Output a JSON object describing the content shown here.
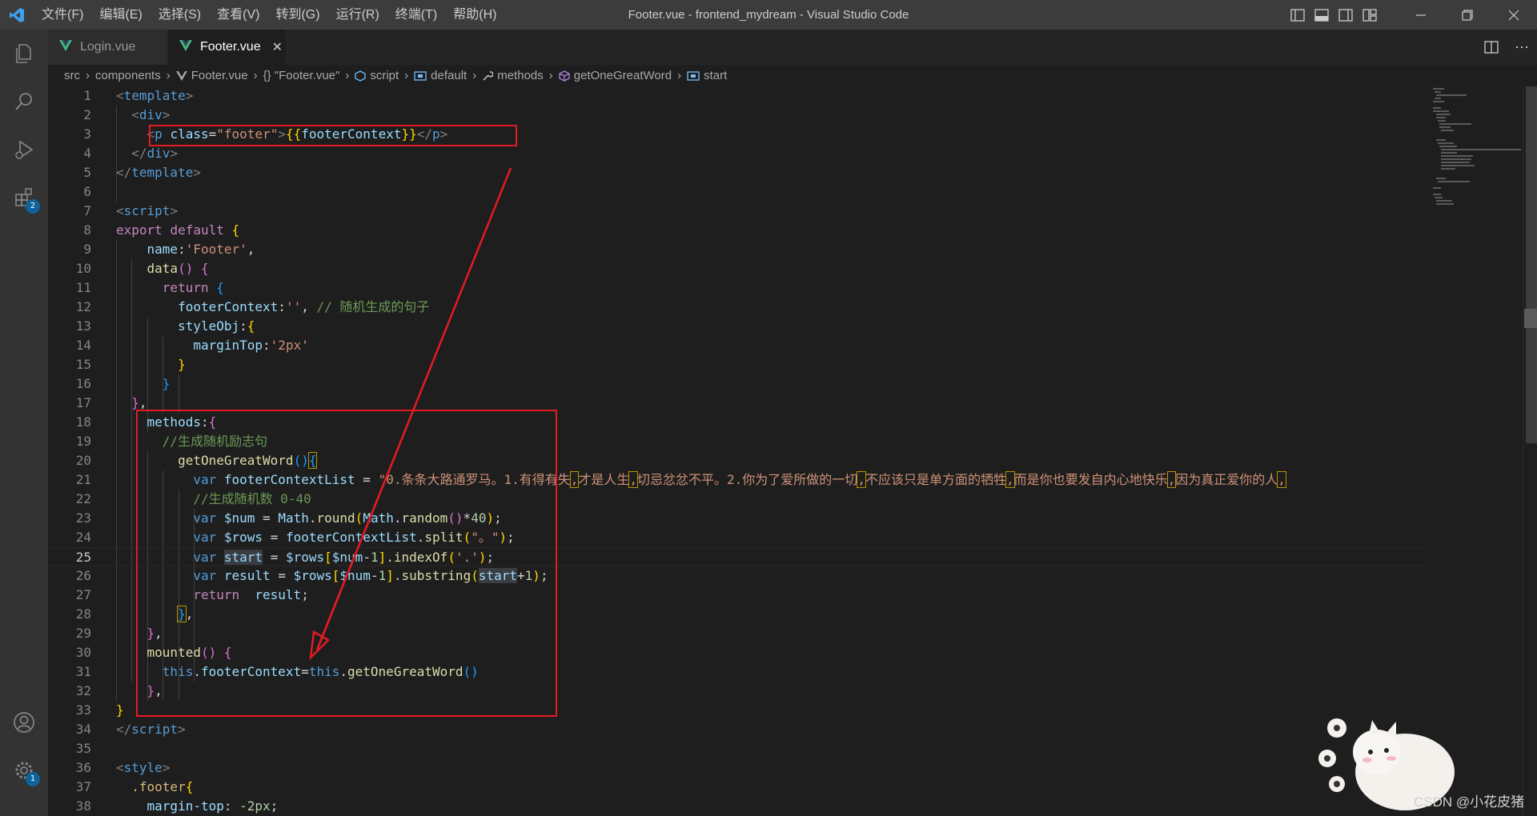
{
  "titlebar": {
    "menu": [
      "文件(F)",
      "编辑(E)",
      "选择(S)",
      "查看(V)",
      "转到(G)",
      "运行(R)",
      "终端(T)",
      "帮助(H)"
    ],
    "title": "Footer.vue - frontend_mydream - Visual Studio Code"
  },
  "activitybar": {
    "extensions_badge": "2",
    "settings_badge": "1"
  },
  "tabs": [
    {
      "label": "Login.vue",
      "active": false
    },
    {
      "label": "Footer.vue",
      "active": true
    }
  ],
  "breadcrumb": [
    "src",
    "components",
    "Footer.vue",
    "{} \"Footer.vue\"",
    "script",
    "default",
    "methods",
    "getOneGreatWord",
    "start"
  ],
  "editor": {
    "current_line": 25,
    "line_numbers": [
      "1",
      "2",
      "3",
      "4",
      "5",
      "6",
      "7",
      "8",
      "9",
      "10",
      "11",
      "12",
      "13",
      "14",
      "15",
      "16",
      "17",
      "18",
      "19",
      "20",
      "21",
      "22",
      "23",
      "24",
      "25",
      "26",
      "27",
      "28",
      "29",
      "30",
      "31",
      "32",
      "33",
      "34",
      "35",
      "36",
      "37",
      "38"
    ],
    "code": {
      "l1_tag": "template",
      "l3_class": "class",
      "l3_classval": "\"footer\"",
      "l3_expr": "footerContext",
      "l7_tag": "script",
      "l8_export": "export",
      "l8_default": "default",
      "l9_name": "name",
      "l9_val": "'Footer'",
      "l10_data": "data",
      "l11_return": "return",
      "l12_key": "footerContext",
      "l12_val": "''",
      "l12_comment": "// 随机生成的句子",
      "l13_key": "styleObj",
      "l14_key": "marginTop",
      "l14_val": "'2px'",
      "l18_methods": "methods",
      "l19_comment": "//生成随机励志句",
      "l20_fn": "getOneGreatWord",
      "l21_var": "var",
      "l21_name": "footerContextList",
      "l21_str_a": "\"0.条条大路通罗马。1.有得有失",
      "l21_str_b": "才是人生",
      "l21_str_c": "切忌忿忿不平。2.你为了爱所做的一切",
      "l21_str_d": "不应该只是单方面的牺牲",
      "l21_str_e": "而是你也要发自内心地快乐",
      "l21_str_f": "因为真正爱你的人",
      "l22_comment": "//生成随机数 0-40",
      "l23_name": "$num",
      "l23_math": "Math",
      "l23_round": "round",
      "l23_random": "random",
      "l23_num": "40",
      "l24_name": "$rows",
      "l24_list": "footerContextList",
      "l24_split": "split",
      "l24_arg": "\"。\"",
      "l25_name": "start",
      "l25_rows": "$rows",
      "l25_num": "$num",
      "l25_one": "1",
      "l25_indexof": "indexOf",
      "l25_arg": "'.'",
      "l26_name": "result",
      "l26_rows": "$rows",
      "l26_num": "$num",
      "l26_one": "1",
      "l26_substring": "substring",
      "l26_start": "start",
      "l26_one2": "1",
      "l27_return": "return",
      "l27_result": "result",
      "l30_mounted": "mounted",
      "l31_this1": "this",
      "l31_prop": "footerContext",
      "l31_this2": "this",
      "l31_fn": "getOneGreatWord",
      "l34_tag": "script",
      "l36_tag": "style",
      "l37_sel": ".footer",
      "l38_prop": "margin-top",
      "l38_val": "-2px"
    }
  },
  "watermark": "CSDN @小花皮猪",
  "colors": {
    "accent": "#007acc",
    "annotation": "#e31b23",
    "background": "#1e1e1e"
  },
  "icons": [
    "vscode-logo-icon",
    "explorer-icon",
    "search-icon",
    "run-debug-icon",
    "extensions-icon",
    "account-icon",
    "settings-gear-icon",
    "vue-file-icon",
    "close-icon",
    "split-editor-icon",
    "more-actions-icon"
  ]
}
